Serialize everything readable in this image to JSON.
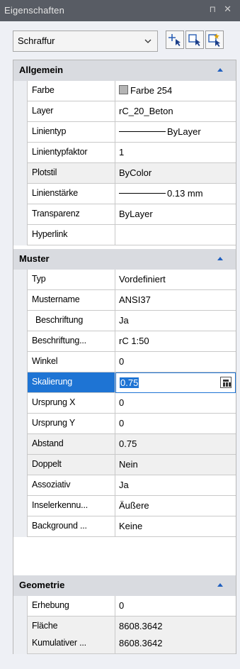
{
  "window": {
    "title": "Eigenschaften",
    "pin_icon": "pin-icon",
    "close_icon": "close-icon"
  },
  "toolbar": {
    "object_type": "Schraffur",
    "buttons": [
      "select-objects-icon",
      "quick-select-icon",
      "toggle-pickadd-icon"
    ]
  },
  "categories": {
    "allgemein": {
      "title": "Allgemein",
      "rows": [
        {
          "name": "Farbe",
          "value": "Farbe 254"
        },
        {
          "name": "Layer",
          "value": "rC_20_Beton"
        },
        {
          "name": "Linientyp",
          "value": "ByLayer"
        },
        {
          "name": "Linientypfaktor",
          "value": "1"
        },
        {
          "name": "Plotstil",
          "value": "ByColor"
        },
        {
          "name": "Linienstärke",
          "value": "0.13 mm"
        },
        {
          "name": "Transparenz",
          "value": "ByLayer"
        },
        {
          "name": "Hyperlink",
          "value": ""
        }
      ]
    },
    "muster": {
      "title": "Muster",
      "rows": [
        {
          "name": "Typ",
          "value": "Vordefiniert"
        },
        {
          "name": "Mustername",
          "value": "ANSI37"
        },
        {
          "name": "Beschriftung",
          "value": "Ja"
        },
        {
          "name": "Beschriftung...",
          "value": "rC 1:50"
        },
        {
          "name": "Winkel",
          "value": "0"
        },
        {
          "name": "Skalierung",
          "value": "0.75"
        },
        {
          "name": "Ursprung X",
          "value": "0"
        },
        {
          "name": "Ursprung Y",
          "value": "0"
        },
        {
          "name": "Abstand",
          "value": "0.75"
        },
        {
          "name": "Doppelt",
          "value": "Nein"
        },
        {
          "name": "Assoziativ",
          "value": "Ja"
        },
        {
          "name": "Inselerkennu...",
          "value": "Äußere"
        },
        {
          "name": "Background ...",
          "value": "Keine"
        }
      ]
    },
    "geometrie": {
      "title": "Geometrie",
      "rows": [
        {
          "name": "Erhebung",
          "value": "0"
        },
        {
          "name": "Fläche",
          "value": "8608.3642"
        },
        {
          "name": "Kumulativer ...",
          "value": "8608.3642"
        }
      ]
    }
  },
  "colors": {
    "selection": "#1e74d4",
    "category_arrow": "#1f5fbf",
    "title_bar": "#585c64"
  }
}
